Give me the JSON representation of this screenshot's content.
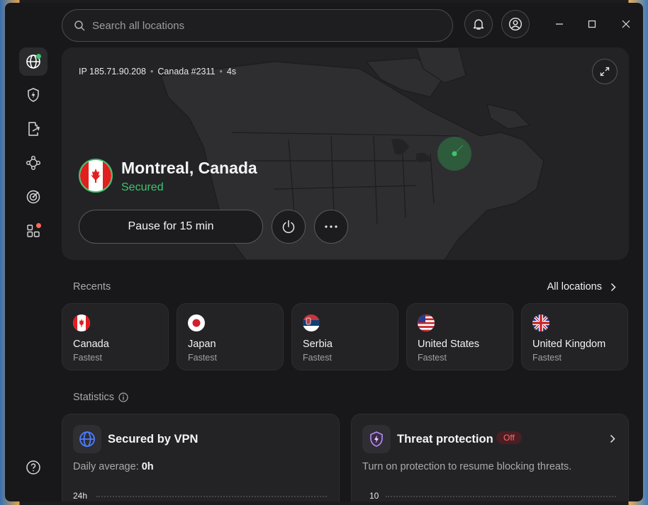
{
  "search": {
    "placeholder": "Search all locations"
  },
  "hero": {
    "ip": "IP 185.71.90.208",
    "server": "Canada #2311",
    "duration": "4s",
    "location": "Montreal, Canada",
    "status": "Secured",
    "pause_label": "Pause for 15 min"
  },
  "recents": {
    "label": "Recents",
    "all_locations": "All locations",
    "items": [
      {
        "name": "Canada",
        "sub": "Fastest",
        "flag": "canada-flag"
      },
      {
        "name": "Japan",
        "sub": "Fastest",
        "flag": "japan-flag"
      },
      {
        "name": "Serbia",
        "sub": "Fastest",
        "flag": "serbia-flag"
      },
      {
        "name": "United States",
        "sub": "Fastest",
        "flag": "us-flag"
      },
      {
        "name": "United Kingdom",
        "sub": "Fastest",
        "flag": "uk-flag"
      }
    ]
  },
  "statistics": {
    "label": "Statistics",
    "vpn": {
      "title": "Secured by VPN",
      "daily_label": "Daily average: ",
      "daily_value": "0h",
      "axis_top": "24h"
    },
    "threat": {
      "title": "Threat protection",
      "badge": "Off",
      "description": "Turn on protection to resume blocking threats.",
      "axis_top": "10"
    }
  },
  "colors": {
    "accent_green": "#3ec46d",
    "off_red": "#ff6b6b",
    "notification_red": "#ff6b5b"
  }
}
